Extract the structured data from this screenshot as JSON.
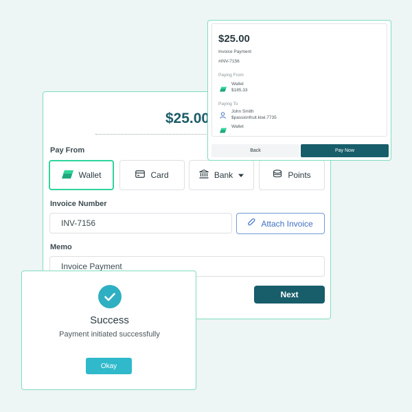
{
  "main": {
    "amount": "$25.00",
    "pay_from_label": "Pay From",
    "methods": [
      {
        "label": "Wallet",
        "icon": "wallet-icon",
        "selected": true
      },
      {
        "label": "Card",
        "icon": "card-icon",
        "selected": false
      },
      {
        "label": "Bank",
        "icon": "bank-icon",
        "selected": false
      },
      {
        "label": "Points",
        "icon": "coins-icon",
        "selected": false
      }
    ],
    "invoice_number_label": "Invoice Number",
    "invoice_number_value": "INV-7156",
    "attach_invoice_label": "Attach Invoice",
    "memo_label": "Memo",
    "memo_value": "Invoice Payment",
    "next_label": "Next"
  },
  "summary": {
    "amount": "$25.00",
    "description": "Invoice Payment",
    "invoice_ref": "#INV-7156",
    "paying_from_label": "Paying From",
    "from_name": "Wallet",
    "from_balance": "$185.33",
    "paying_to_label": "Paying To",
    "to_name": "John Smith",
    "to_handle": "$passionfruit.kiwi.7735",
    "to_method": "Wallet",
    "back_label": "Back",
    "pay_now_label": "Pay Now"
  },
  "success": {
    "title": "Success",
    "message": "Payment initiated successfully",
    "okay_label": "Okay"
  },
  "colors": {
    "accent_dark": "#175d6a",
    "accent_teal": "#2fb9ca",
    "selected_border": "#2fd49a",
    "panel_border": "#7fdcc0",
    "background": "#eef5f5"
  }
}
